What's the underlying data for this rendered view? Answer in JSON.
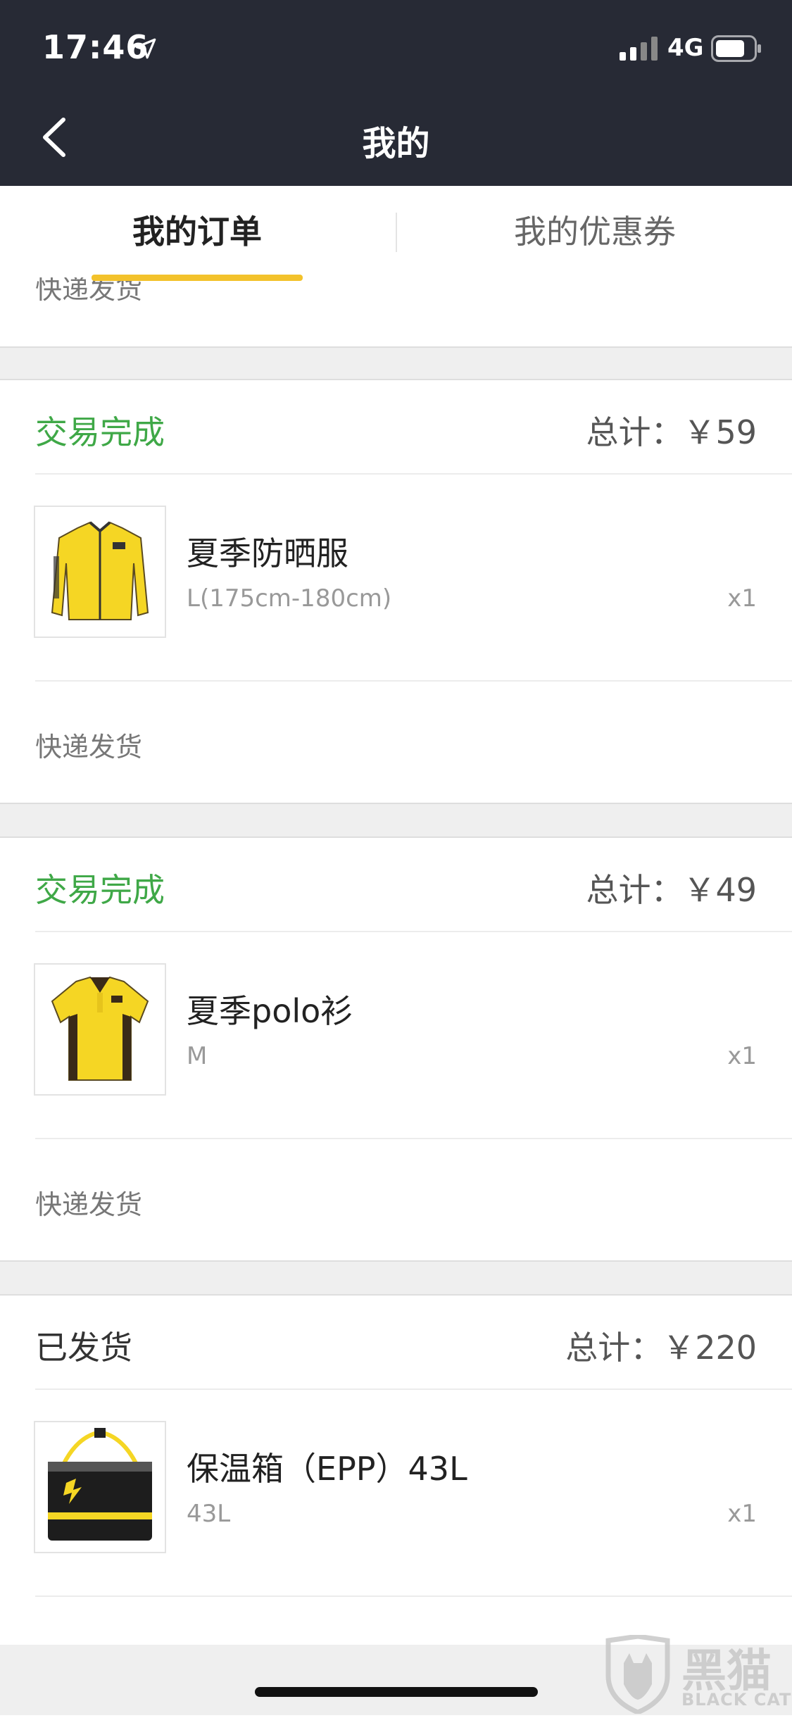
{
  "status_bar": {
    "time": "17:46",
    "network": "4G"
  },
  "nav": {
    "title": "我的"
  },
  "tabs": [
    {
      "label": "我的订单",
      "active": true
    },
    {
      "label": "我的优惠券",
      "active": false
    }
  ],
  "partial_order": {
    "shipping": "快递发货"
  },
  "orders": [
    {
      "status": "交易完成",
      "total": "总计：￥59",
      "product": {
        "name": "夏季防晒服",
        "spec": "L(175cm-180cm)",
        "qty": "x1",
        "icon": "yellow-jacket-image"
      },
      "shipping": "快递发货"
    },
    {
      "status": "交易完成",
      "total": "总计：￥49",
      "product": {
        "name": "夏季polo衫",
        "spec": "M",
        "qty": "x1",
        "icon": "yellow-polo-shirt-image"
      },
      "shipping": "快递发货"
    },
    {
      "status": "已发货",
      "total": "总计：￥220",
      "product": {
        "name": "保温箱（EPP）43L",
        "spec": "43L",
        "qty": "x1",
        "icon": "delivery-box-image"
      }
    }
  ],
  "watermark": {
    "cn": "黑猫",
    "en": "BLACK CAT"
  },
  "colors": {
    "header_bg": "#272a35",
    "accent_yellow": "#f3c22b",
    "status_done_green": "#3fa847"
  }
}
